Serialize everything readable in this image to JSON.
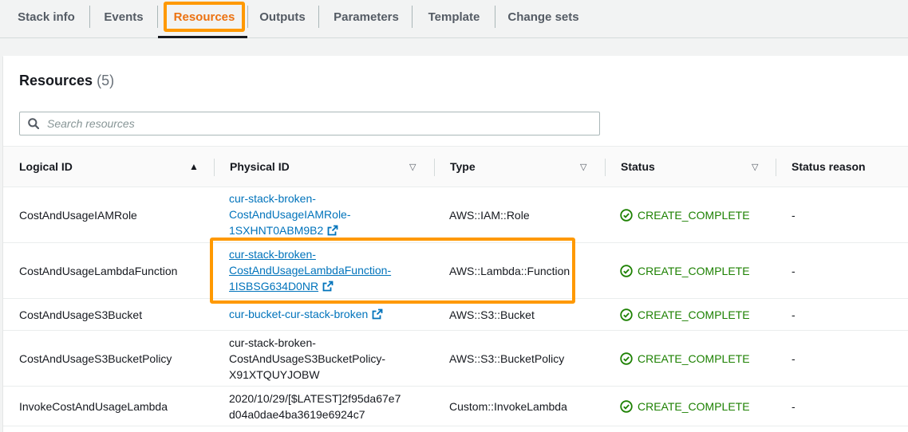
{
  "tabs": [
    {
      "label": "Stack info"
    },
    {
      "label": "Events"
    },
    {
      "label": "Resources"
    },
    {
      "label": "Outputs"
    },
    {
      "label": "Parameters"
    },
    {
      "label": "Template"
    },
    {
      "label": "Change sets"
    }
  ],
  "active_tab": "Resources",
  "panel": {
    "title": "Resources",
    "count": "(5)",
    "search_placeholder": "Search resources"
  },
  "table": {
    "columns": [
      {
        "label": "Logical ID",
        "sort": "ascending"
      },
      {
        "label": "Physical ID",
        "sort": "none"
      },
      {
        "label": "Type",
        "sort": "none"
      },
      {
        "label": "Status",
        "sort": "none"
      },
      {
        "label": "Status reason",
        "sort": "none"
      }
    ],
    "rows": [
      {
        "logical_id": "CostAndUsageIAMRole",
        "physical_id_lines": [
          "cur-stack-broken-",
          "CostAndUsageIAMRole-",
          "1SXHNT0ABM9B2"
        ],
        "physical_is_link": true,
        "type": "AWS::IAM::Role",
        "status": "CREATE_COMPLETE",
        "status_reason": "-"
      },
      {
        "logical_id": "CostAndUsageLambdaFunction",
        "physical_id_lines": [
          "cur-stack-broken-",
          "CostAndUsageLambdaFunction-",
          "1ISBSG634D0NR"
        ],
        "physical_is_link": true,
        "type": "AWS::Lambda::Function",
        "status": "CREATE_COMPLETE",
        "status_reason": "-"
      },
      {
        "logical_id": "CostAndUsageS3Bucket",
        "physical_id_lines": [
          "cur-bucket-cur-stack-broken"
        ],
        "physical_is_link": true,
        "type": "AWS::S3::Bucket",
        "status": "CREATE_COMPLETE",
        "status_reason": "-"
      },
      {
        "logical_id": "CostAndUsageS3BucketPolicy",
        "physical_id_lines": [
          "cur-stack-broken-",
          "CostAndUsageS3BucketPolicy-",
          "X91XTQUYJOBW"
        ],
        "physical_is_link": false,
        "type": "AWS::S3::BucketPolicy",
        "status": "CREATE_COMPLETE",
        "status_reason": "-"
      },
      {
        "logical_id": "InvokeCostAndUsageLambda",
        "physical_id_lines": [
          "2020/10/29/[$LATEST]2f95da67e7",
          "d04a0dae4ba3619e6924c7"
        ],
        "physical_is_link": false,
        "type": "Custom::InvokeLambda",
        "status": "CREATE_COMPLETE",
        "status_reason": "-"
      }
    ]
  },
  "colors": {
    "accent_orange": "#ec7211",
    "highlight_orange": "#ff9900",
    "link_blue": "#0073bb",
    "success_green": "#1d8102"
  }
}
